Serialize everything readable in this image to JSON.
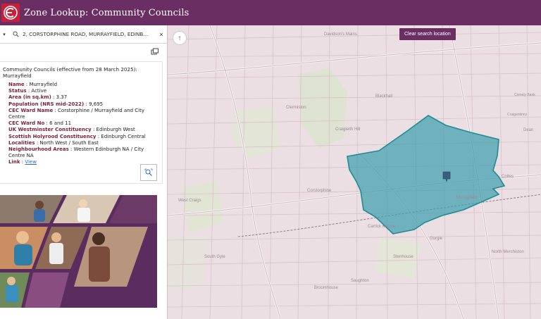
{
  "header": {
    "title": "Zone Lookup: Community Councils",
    "brand_color": "#6b2e63",
    "logo_color": "#c8203a",
    "logo_icon": "edinburgh-e-logo"
  },
  "search": {
    "value": "2, CORSTORPHINE ROAD, MURRAYFIELD, EDINB...",
    "close_label": "×"
  },
  "popup": {
    "title": "Community Councils (effective from 28 March 2025): Murrayfield",
    "attributes": [
      {
        "key": "Name",
        "value": "Murrayfield"
      },
      {
        "key": "Status",
        "value": "Active"
      },
      {
        "key": "Area (in sq.km)",
        "value": "3.37"
      },
      {
        "key": "Population (NRS mid-2022)",
        "value": "9,695"
      },
      {
        "key": "CEC Ward Name",
        "value": "Corstorphine / Murrayfield and City Centre"
      },
      {
        "key": "CEC Ward No",
        "value": "6 and 11"
      },
      {
        "key": "UK Westminster Constituency",
        "value": "Edinburgh West"
      },
      {
        "key": "Scottish Holyrood Constituency",
        "value": "Edinburgh Central"
      },
      {
        "key": "Localities",
        "value": "North West / South East"
      },
      {
        "key": "Neighbourhood Areas",
        "value": "Western Edinburgh NA / City Centre NA"
      }
    ],
    "link_key": "Link",
    "link_text": "View",
    "key_color": "#7a1f3d",
    "link_color": "#2d6fb3"
  },
  "map": {
    "clear_button": "Clear search location",
    "highlight_color": "#3e9fae",
    "labels": [
      {
        "text": "Davidson's Mains"
      },
      {
        "text": "Blackhall"
      },
      {
        "text": "Craigleith Hill"
      },
      {
        "text": "Clermiston"
      },
      {
        "text": "Corstorphine"
      },
      {
        "text": "Carrick Knowe"
      },
      {
        "text": "Stenhouse"
      },
      {
        "text": "North Merchiston"
      },
      {
        "text": "Dean"
      },
      {
        "text": "Coltes"
      },
      {
        "text": "Comely Bank"
      },
      {
        "text": "Craigentinny"
      },
      {
        "text": "South Gyle"
      },
      {
        "text": "Broomhouse"
      },
      {
        "text": "Saughton"
      },
      {
        "text": "Murrayfield"
      },
      {
        "text": "West Craigs"
      },
      {
        "text": "Gorgie"
      }
    ]
  }
}
